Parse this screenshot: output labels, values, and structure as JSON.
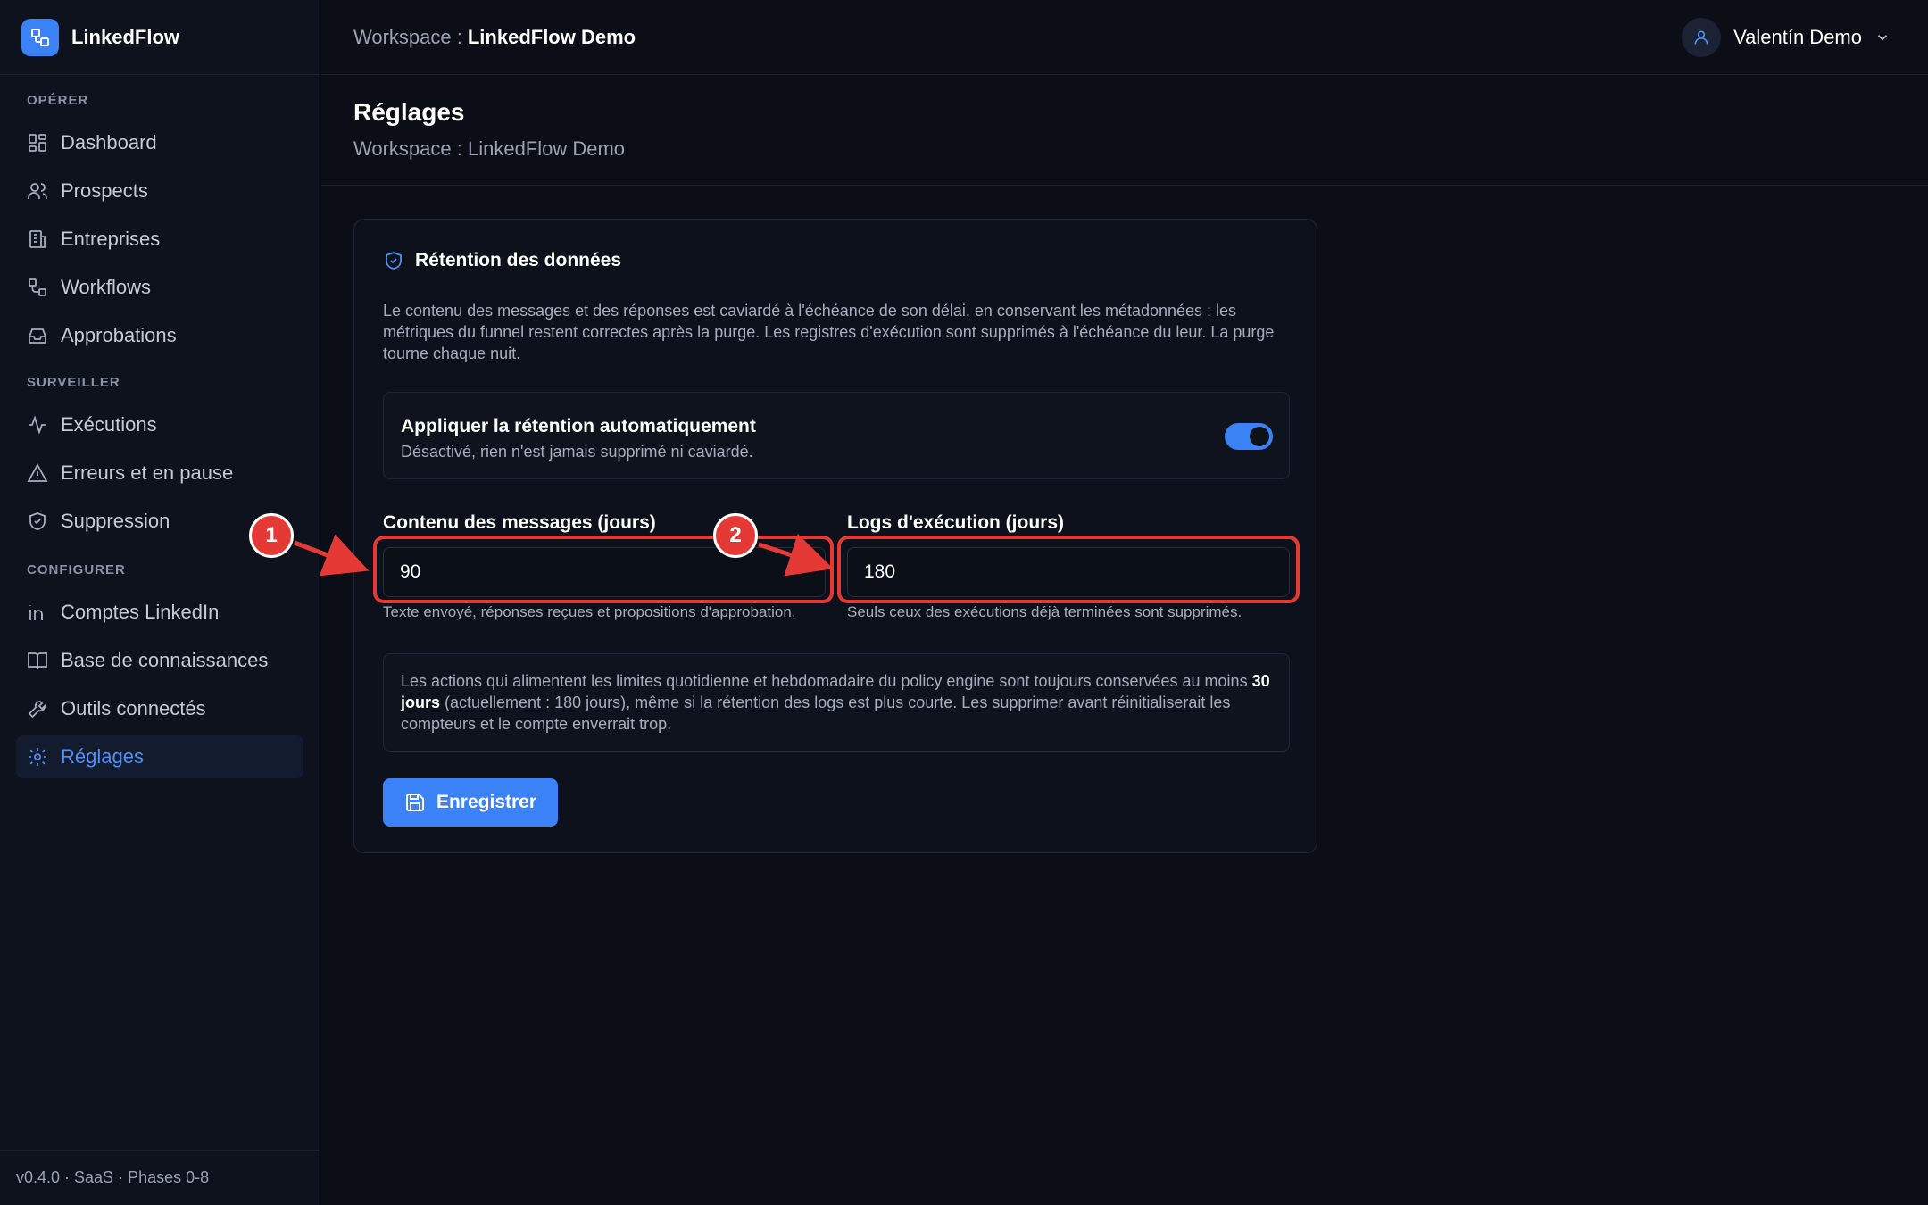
{
  "brand": {
    "name": "LinkedFlow"
  },
  "sidebar": {
    "sections": [
      {
        "title": "OPÉRER",
        "items": [
          {
            "label": "Dashboard",
            "icon": "dashboard-icon"
          },
          {
            "label": "Prospects",
            "icon": "users-icon"
          },
          {
            "label": "Entreprises",
            "icon": "building-icon"
          },
          {
            "label": "Workflows",
            "icon": "workflow-icon"
          },
          {
            "label": "Approbations",
            "icon": "inbox-icon"
          }
        ]
      },
      {
        "title": "SURVEILLER",
        "items": [
          {
            "label": "Exécutions",
            "icon": "activity-icon"
          },
          {
            "label": "Erreurs et en pause",
            "icon": "warning-icon"
          },
          {
            "label": "Suppression",
            "icon": "shield-icon"
          }
        ]
      },
      {
        "title": "CONFIGURER",
        "items": [
          {
            "label": "Comptes LinkedIn",
            "icon": "linkedin-icon"
          },
          {
            "label": "Base de connaissances",
            "icon": "book-icon"
          },
          {
            "label": "Outils connectés",
            "icon": "wrench-icon"
          },
          {
            "label": "Réglages",
            "icon": "gear-icon",
            "active": true
          }
        ]
      }
    ],
    "footer": "v0.4.0 · SaaS · Phases 0-8"
  },
  "topbar": {
    "workspace_label": "Workspace :",
    "workspace_name": "LinkedFlow Demo",
    "user_name": "Valentín Demo"
  },
  "page": {
    "title": "Réglages",
    "subtitle": "Workspace : LinkedFlow Demo"
  },
  "retention": {
    "title": "Rétention des données",
    "description": "Le contenu des messages et des réponses est caviardé à l'échéance de son délai, en conservant les métadonnées : les métriques du funnel restent correctes après la purge. Les registres d'exécution sont supprimés à l'échéance du leur. La purge tourne chaque nuit.",
    "toggle": {
      "label": "Appliquer la rétention automatiquement",
      "hint": "Désactivé, rien n'est jamais supprimé ni caviardé.",
      "enabled": true
    },
    "messages_field": {
      "label": "Contenu des messages (jours)",
      "value": "90",
      "hint": "Texte envoyé, réponses reçues et propositions d'approbation."
    },
    "logs_field": {
      "label": "Logs d'exécution (jours)",
      "value": "180",
      "hint": "Seuls ceux des exécutions déjà terminées sont supprimés."
    },
    "info": {
      "before": "Les actions qui alimentent les limites quotidienne et hebdomadaire du policy engine sont toujours conservées au moins ",
      "bold": "30 jours",
      "after": " (actuellement : 180 jours), même si la rétention des logs est plus courte. Les supprimer avant réinitialiserait les compteurs et le compte enverrait trop."
    },
    "save_label": "Enregistrer"
  },
  "annotations": {
    "badge1": "1",
    "badge2": "2",
    "color": "#e53935"
  },
  "colors": {
    "accent": "#3b82f6",
    "background": "#0b0e16",
    "sidebar": "#0e121c"
  }
}
